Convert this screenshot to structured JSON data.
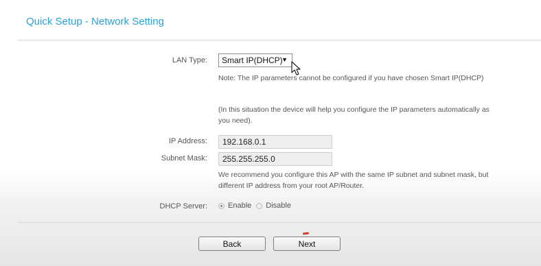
{
  "header": {
    "title": "Quick Setup - Network Setting"
  },
  "form": {
    "lan_type": {
      "label": "LAN Type:",
      "selected": "Smart IP(DHCP)",
      "caret": "▼"
    },
    "note1": "Note: The IP parameters cannot be configured if you have chosen Smart IP(DHCP)",
    "note2": "(In this situation the device will help you configure the IP parameters automatically as you need).",
    "ip_address": {
      "label": "IP Address:",
      "value": "192.168.0.1"
    },
    "subnet_mask": {
      "label": "Subnet Mask:",
      "value": "255.255.255.0"
    },
    "recommend": "We recommend you configure this AP with the same IP subnet and subnet mask, but different IP address from your root AP/Router.",
    "dhcp_server": {
      "label": "DHCP Server:",
      "options": [
        "Enable",
        "Disable"
      ],
      "selected": "Enable"
    }
  },
  "buttons": {
    "back": "Back",
    "next": "Next"
  },
  "colors": {
    "title": "#2ba2d4",
    "divider": "#d6d6d6",
    "field_background": "#eeeeee"
  },
  "icons": {
    "mouse_cursor": "arrow-pointer-icon"
  }
}
